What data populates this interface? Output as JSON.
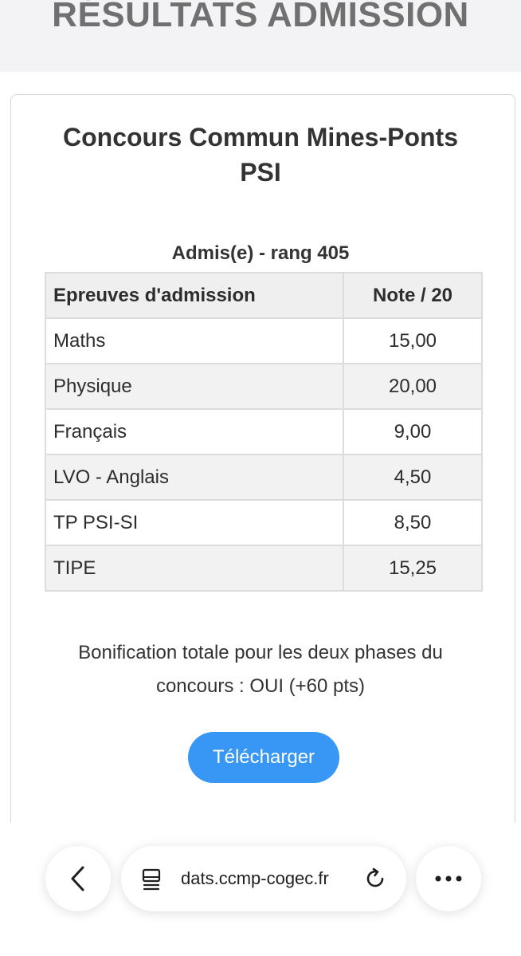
{
  "header": {
    "title": "RÉSULTATS ADMISSION"
  },
  "card": {
    "title_line1": "Concours Commun Mines-Ponts",
    "title_line2": "PSI",
    "status": "Admis(e) - rang 405",
    "table": {
      "headers": [
        "Epreuves d'admission",
        "Note / 20"
      ],
      "rows": [
        [
          "Maths",
          "15,00"
        ],
        [
          "Physique",
          "20,00"
        ],
        [
          "Français",
          "9,00"
        ],
        [
          "LVO - Anglais",
          "4,50"
        ],
        [
          "TP PSI-SI",
          "8,50"
        ],
        [
          "TIPE",
          "15,25"
        ]
      ]
    },
    "bonus_line1": "Bonification totale pour les deux phases du",
    "bonus_line2": "concours : OUI (+60 pts)",
    "download_label": "Télécharger"
  },
  "browser": {
    "url": "dats.ccmp-cogec.fr",
    "icons": [
      "back-chevron-icon",
      "tab-view-icon",
      "reload-icon",
      "more-dots-icon"
    ]
  },
  "colors": {
    "accent": "#3897f5",
    "header_bg": "#f3f3f5"
  }
}
